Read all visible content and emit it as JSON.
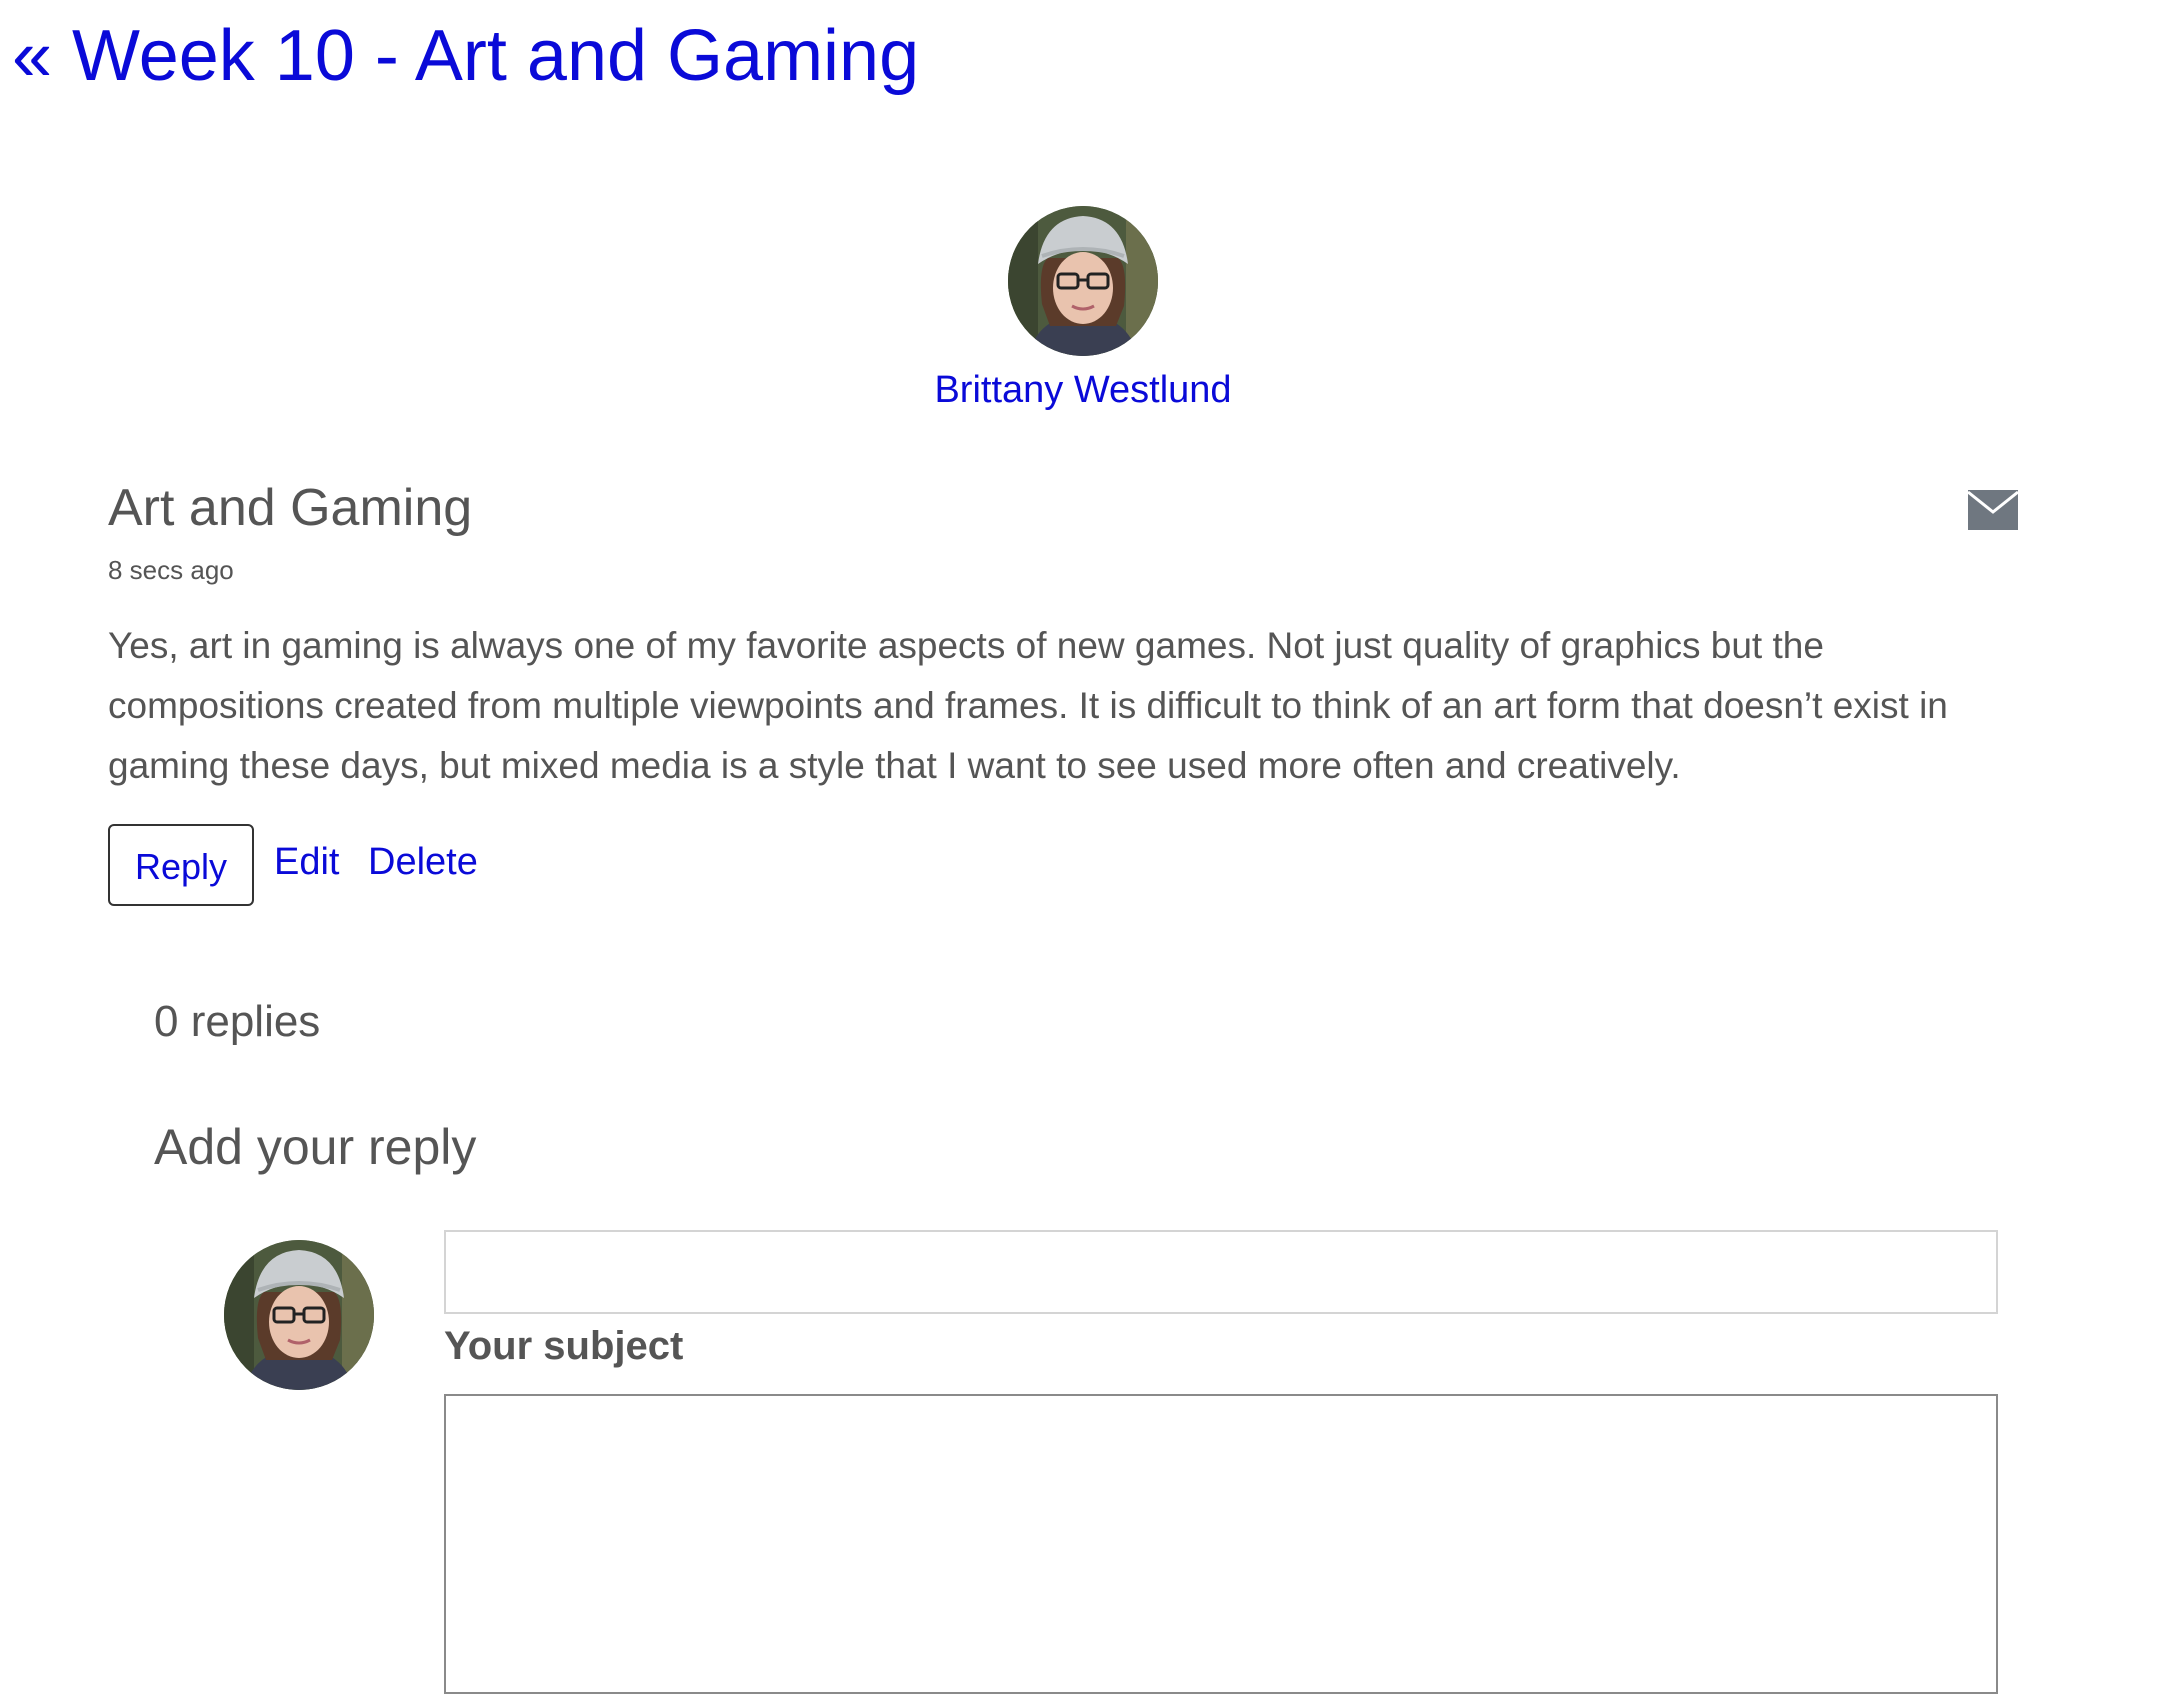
{
  "back_link": {
    "label": "« Week 10 - Art and Gaming"
  },
  "author": {
    "name": "Brittany Westlund",
    "avatar_icon": "user-avatar-photo"
  },
  "post": {
    "title": "Art and Gaming",
    "time_ago": "8 secs ago",
    "body": "Yes, art in gaming is always one of my favorite aspects of new games. Not just quality of graphics but the compositions created from multiple viewpoints and frames. It is difficult to think of an art form that doesn’t exist in gaming these days, but mixed media is a style that I want to see used more often and creatively.",
    "mail_icon": "envelope-icon"
  },
  "actions": {
    "reply_label": "Reply",
    "edit_label": "Edit",
    "delete_label": "Delete"
  },
  "replies": {
    "count_label": "0 replies",
    "add_heading": "Add your reply"
  },
  "reply_form": {
    "subject_value": "",
    "subject_label": "Your subject",
    "body_value": ""
  },
  "colors": {
    "link": "#0a0ad8",
    "text": "#555555",
    "icon": "#6f7780"
  }
}
